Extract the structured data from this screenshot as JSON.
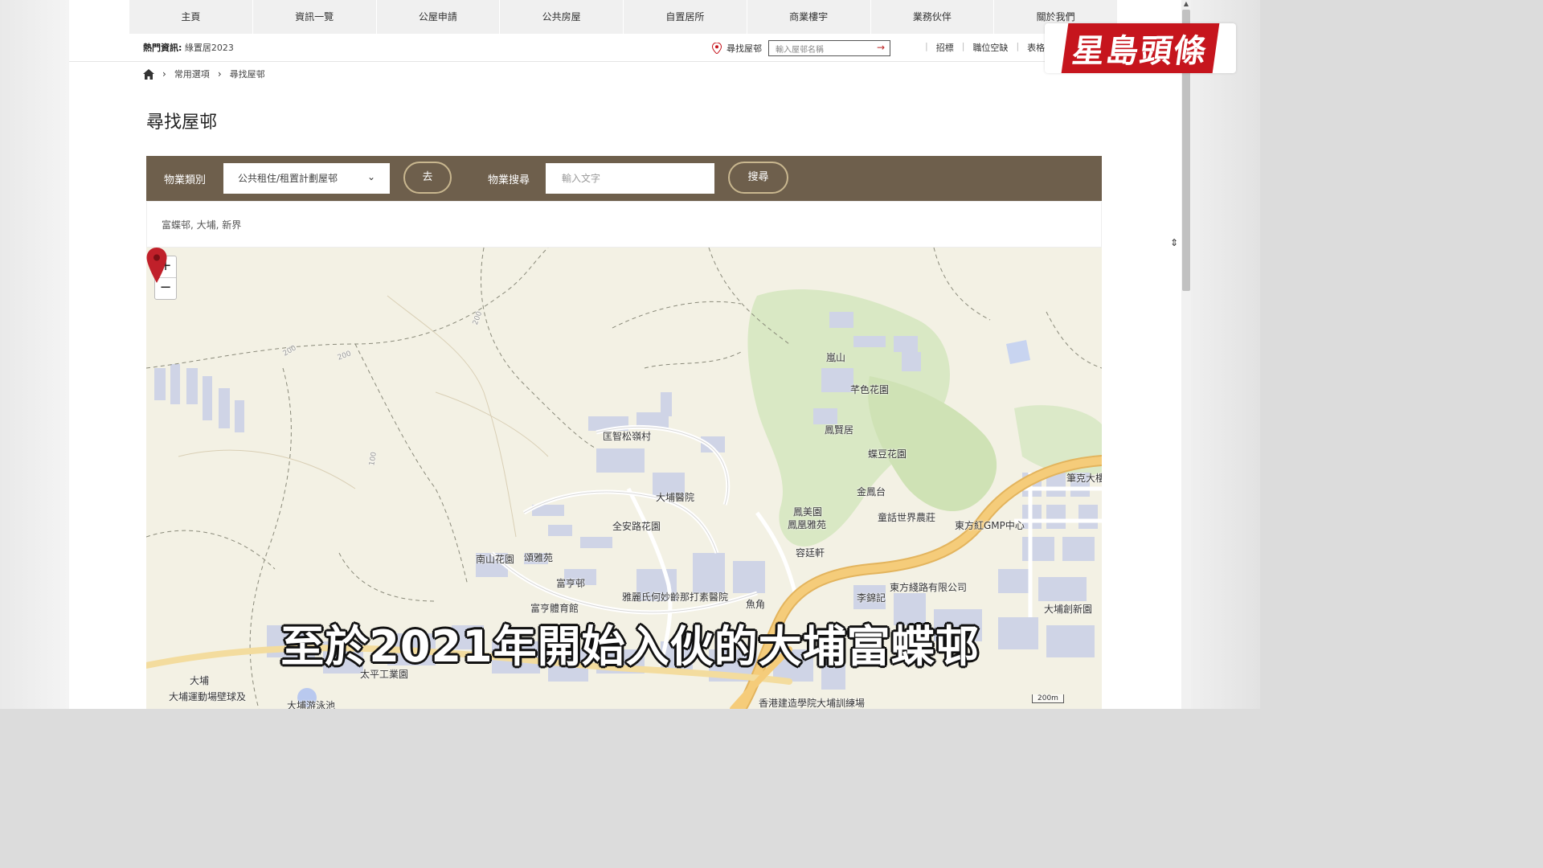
{
  "nav": [
    "主頁",
    "資訊一覽",
    "公屋申請",
    "公共房屋",
    "自置居所",
    "商業樓宇",
    "業務伙伴",
    "關於我們"
  ],
  "infobar": {
    "hot_label": "熱門資訊:",
    "hot_value": "綠置居2023",
    "finder_label": "尋找屋邨",
    "finder_placeholder": "輸入屋邨名稱",
    "links": [
      "招標",
      "職位空缺",
      "表格"
    ]
  },
  "logo": "星島頭條",
  "breadcrumb": [
    "常用選項",
    "尋找屋邨"
  ],
  "page_title": "尋找屋邨",
  "filter": {
    "category_label": "物業類別",
    "category_value": "公共租住/租置計劃屋邨",
    "go_label": "去",
    "search_label": "物業搜尋",
    "search_placeholder": "輸入文字",
    "search_button": "搜尋"
  },
  "result": "富蝶邨, 大埔, 新界",
  "map": {
    "zoom_in": "+",
    "zoom_out": "−",
    "places": {
      "p1": "嵐山",
      "p2": "芊色花園",
      "p3": "鳳賢居",
      "p4": "蝶豆花園",
      "p5": "金鳳台",
      "p6": "匡智松嶺村",
      "p7": "大埔醫院",
      "p8": "全安路花園",
      "p9": "鳳美園",
      "p10": "鳳凰雅苑",
      "p11": "童話世界農莊",
      "p12": "東方紅GMP中心",
      "p13": "筆克大樓",
      "p14": "容廷軒",
      "p15": "南山花園",
      "p16": "頌雅苑",
      "p17": "富亨邨",
      "p18": "富亨體育館",
      "p19": "雅麗氏何妙齡那打素醫院",
      "p20": "魚角",
      "p21": "東方綫路有限公司",
      "p22": "李錦記",
      "p23": "大埔創新園",
      "p24": "太平工業園",
      "p25": "大埔運動場壁球及",
      "p26": "大埔",
      "p27": "大埔游泳池",
      "p28": "香港建造學院大埔訓練場"
    },
    "contours": [
      "200",
      "200",
      "200",
      "100"
    ],
    "scale": "200m"
  },
  "caption": "至於2021年開始入伙的大埔富蝶邨"
}
